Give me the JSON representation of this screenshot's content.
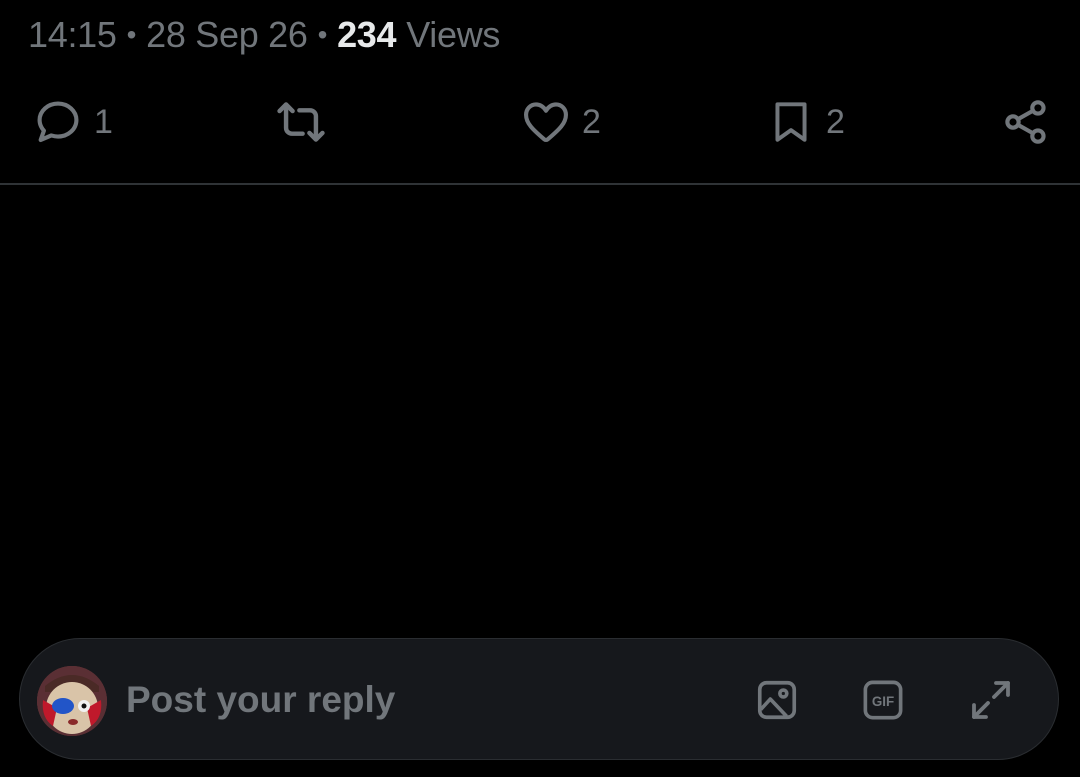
{
  "post_meta": {
    "time": "14:15",
    "separator": "•",
    "date": "28 Sep 26",
    "views_count": "234",
    "views_label": "Views"
  },
  "actions": {
    "reply": {
      "icon": "reply-icon",
      "count": "1"
    },
    "repost": {
      "icon": "repost-icon",
      "count": ""
    },
    "like": {
      "icon": "heart-icon",
      "count": "2"
    },
    "bookmark": {
      "icon": "bookmark-icon",
      "count": "2"
    },
    "share": {
      "icon": "share-icon"
    }
  },
  "reply_bar": {
    "avatar_icon": "user-avatar",
    "placeholder": "Post your reply",
    "tools": [
      "image-icon",
      "gif-icon",
      "expand-icon"
    ],
    "gif_label": "GIF"
  },
  "colors": {
    "background": "#000000",
    "muted": "#71767b",
    "text": "#e7e9ea",
    "divider": "#2f3336",
    "reply_bar_bg": "#16181c"
  }
}
